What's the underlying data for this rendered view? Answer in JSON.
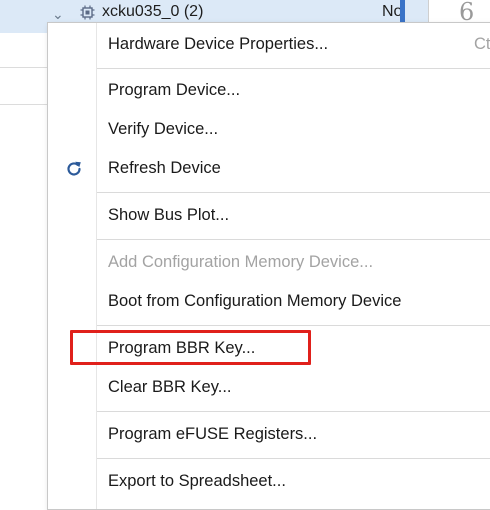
{
  "tree": {
    "device_label": "xcku035_0 (2)",
    "status_text": "No",
    "extra_text": "6"
  },
  "menu": {
    "items": [
      {
        "label": "Hardware Device Properties...",
        "shortcut": "Ct"
      },
      {
        "label": "Program Device..."
      },
      {
        "label": "Verify Device..."
      },
      {
        "label": "Refresh Device",
        "icon": "refresh-icon"
      },
      {
        "label": "Show Bus Plot..."
      },
      {
        "label": "Add Configuration Memory Device...",
        "disabled": true
      },
      {
        "label": "Boot from Configuration Memory Device"
      },
      {
        "label": "Program BBR Key..."
      },
      {
        "label": "Clear BBR Key..."
      },
      {
        "label": "Program eFUSE Registers..."
      },
      {
        "label": "Export to Spreadsheet..."
      }
    ]
  },
  "colors": {
    "highlight": "#e0201b",
    "refresh_icon": "#2c5a9a",
    "selection": "#dce9f7"
  }
}
